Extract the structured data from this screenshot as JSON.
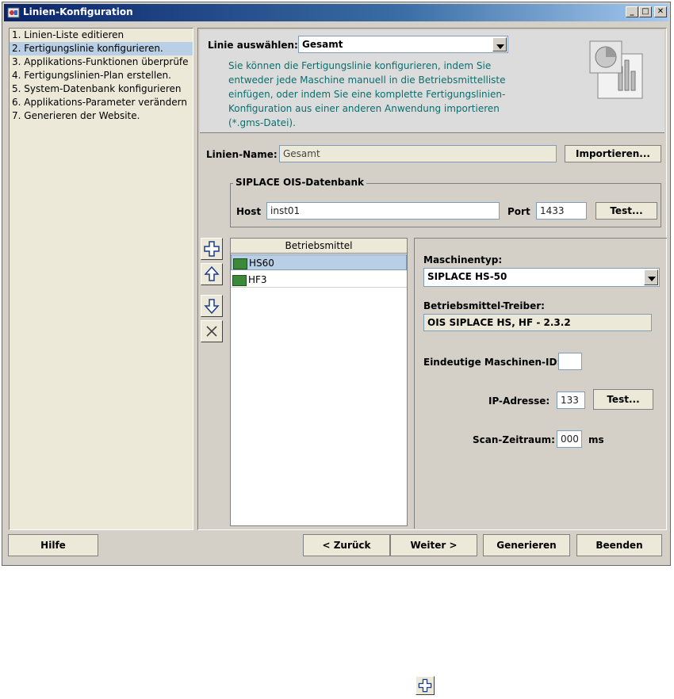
{
  "window": {
    "title": "Linien-Konfiguration"
  },
  "steps": [
    "1. Linien-Liste editieren",
    "2. Fertigungslinie konfigurieren.",
    "3. Applikations-Funktionen überprüfe",
    "4. Fertigungslinien-Plan erstellen.",
    "5. System-Datenbank konfigurieren",
    "6. Applikations-Parameter verändern",
    "7. Generieren der Website."
  ],
  "header": {
    "line_label": "Linie auswählen:",
    "line_value": "Gesamt",
    "info": "Sie können die Fertigungslinie konfigurieren, indem Sie entweder jede Maschine manuell in die Betriebsmittelliste einfügen, oder indem Sie eine komplette Fertigungslinien-Konfiguration aus einer anderen Anwendung importieren (*.gms-Datei)."
  },
  "line_name": {
    "label": "Linien-Name:",
    "value": "Gesamt",
    "import_label": "Importieren..."
  },
  "database": {
    "title": "SIPLACE OIS-Datenbank",
    "host_label": "Host",
    "host_value": "inst01",
    "port_label": "Port",
    "port_value": "1433",
    "test_label": "Test..."
  },
  "resources": {
    "header": "Betriebsmittel",
    "items": [
      "HS60",
      "HF3"
    ]
  },
  "details": {
    "machine_type_label": "Maschinentyp:",
    "machine_type_value": "SIPLACE HS-50",
    "driver_label": "Betriebsmittel-Treiber:",
    "driver_value": "OIS SIPLACE HS, HF - 2.3.2",
    "machine_id_label": "Eindeutige Maschinen-ID:",
    "ip_label": "IP-Adresse:",
    "ip_value": "133",
    "ip_test_label": "Test...",
    "scan_label": "Scan-Zeitraum:",
    "scan_value": "000",
    "scan_unit": "ms"
  },
  "buttons": {
    "help": "Hilfe",
    "back": "< Zurück",
    "next": "Weiter >",
    "generate": "Generieren",
    "finish": "Beenden"
  }
}
